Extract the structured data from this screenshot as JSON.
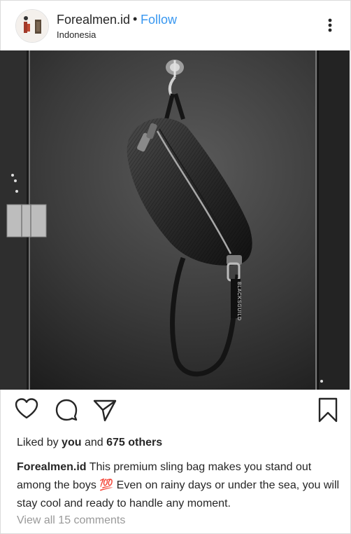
{
  "post": {
    "username": "Forealmen.id",
    "separator": "•",
    "follow_label": "Follow",
    "location": "Indonesia",
    "likes_prefix": "Liked by",
    "likes_user": "you",
    "likes_middle": "and",
    "likes_count": "675 others",
    "caption_user": "Forealmen.id",
    "caption_text": "This premium sling bag makes you stand out among the boys 💯 Even on rainy days or under the sea, you will stay cool and ready to handle any moment.",
    "comments_link": "View all 15 comments"
  },
  "bag_tag_text": "BLACKSGUILD",
  "icons": {
    "more": "more-vertical-icon",
    "like": "heart-icon",
    "comment": "comment-bubble-icon",
    "share": "paper-plane-icon",
    "save": "bookmark-icon"
  },
  "colors": {
    "accent": "#3897f0",
    "text": "#262626",
    "muted": "#999999",
    "border": "#dbdbdb"
  }
}
